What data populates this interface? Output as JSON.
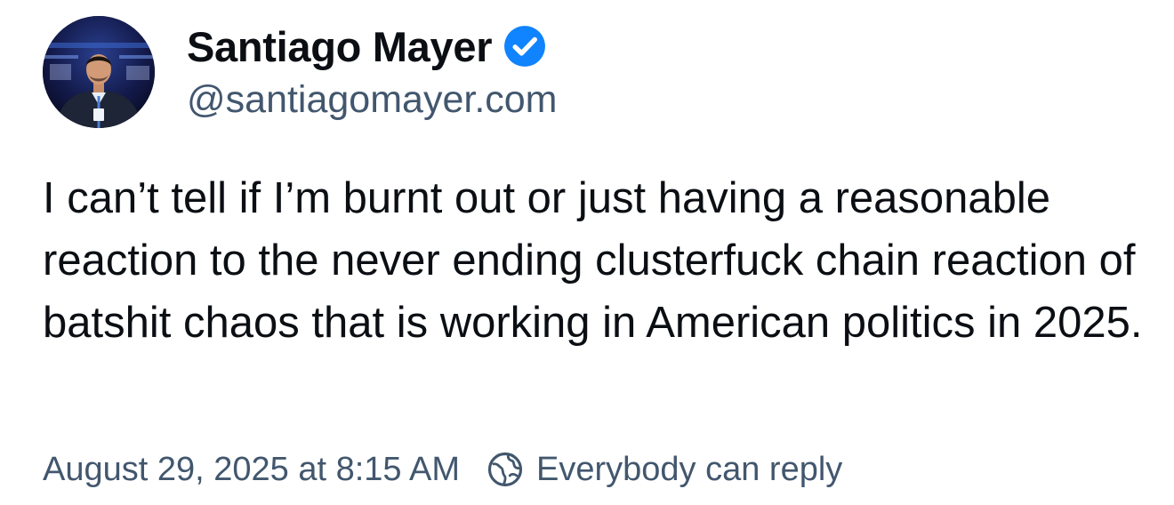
{
  "author": {
    "display_name": "Santiago Mayer",
    "handle": "@santiagomayer.com",
    "verified": true,
    "verified_icon": "verified-checkmark-icon",
    "avatar": "profile-photo"
  },
  "post": {
    "text": "I can’t tell if I’m burnt out or just having a reasonable reaction to the never ending clusterfuck chain reaction of batshit chaos that is working in American politics in 2025."
  },
  "meta": {
    "timestamp": "August 29, 2025 at 8:15 AM",
    "reply_setting_label": "Everybody can reply",
    "reply_setting_icon": "globe-icon"
  },
  "colors": {
    "text": "#0b0f14",
    "secondary": "#42576e",
    "verified": "#1083fe",
    "background": "#ffffff"
  }
}
